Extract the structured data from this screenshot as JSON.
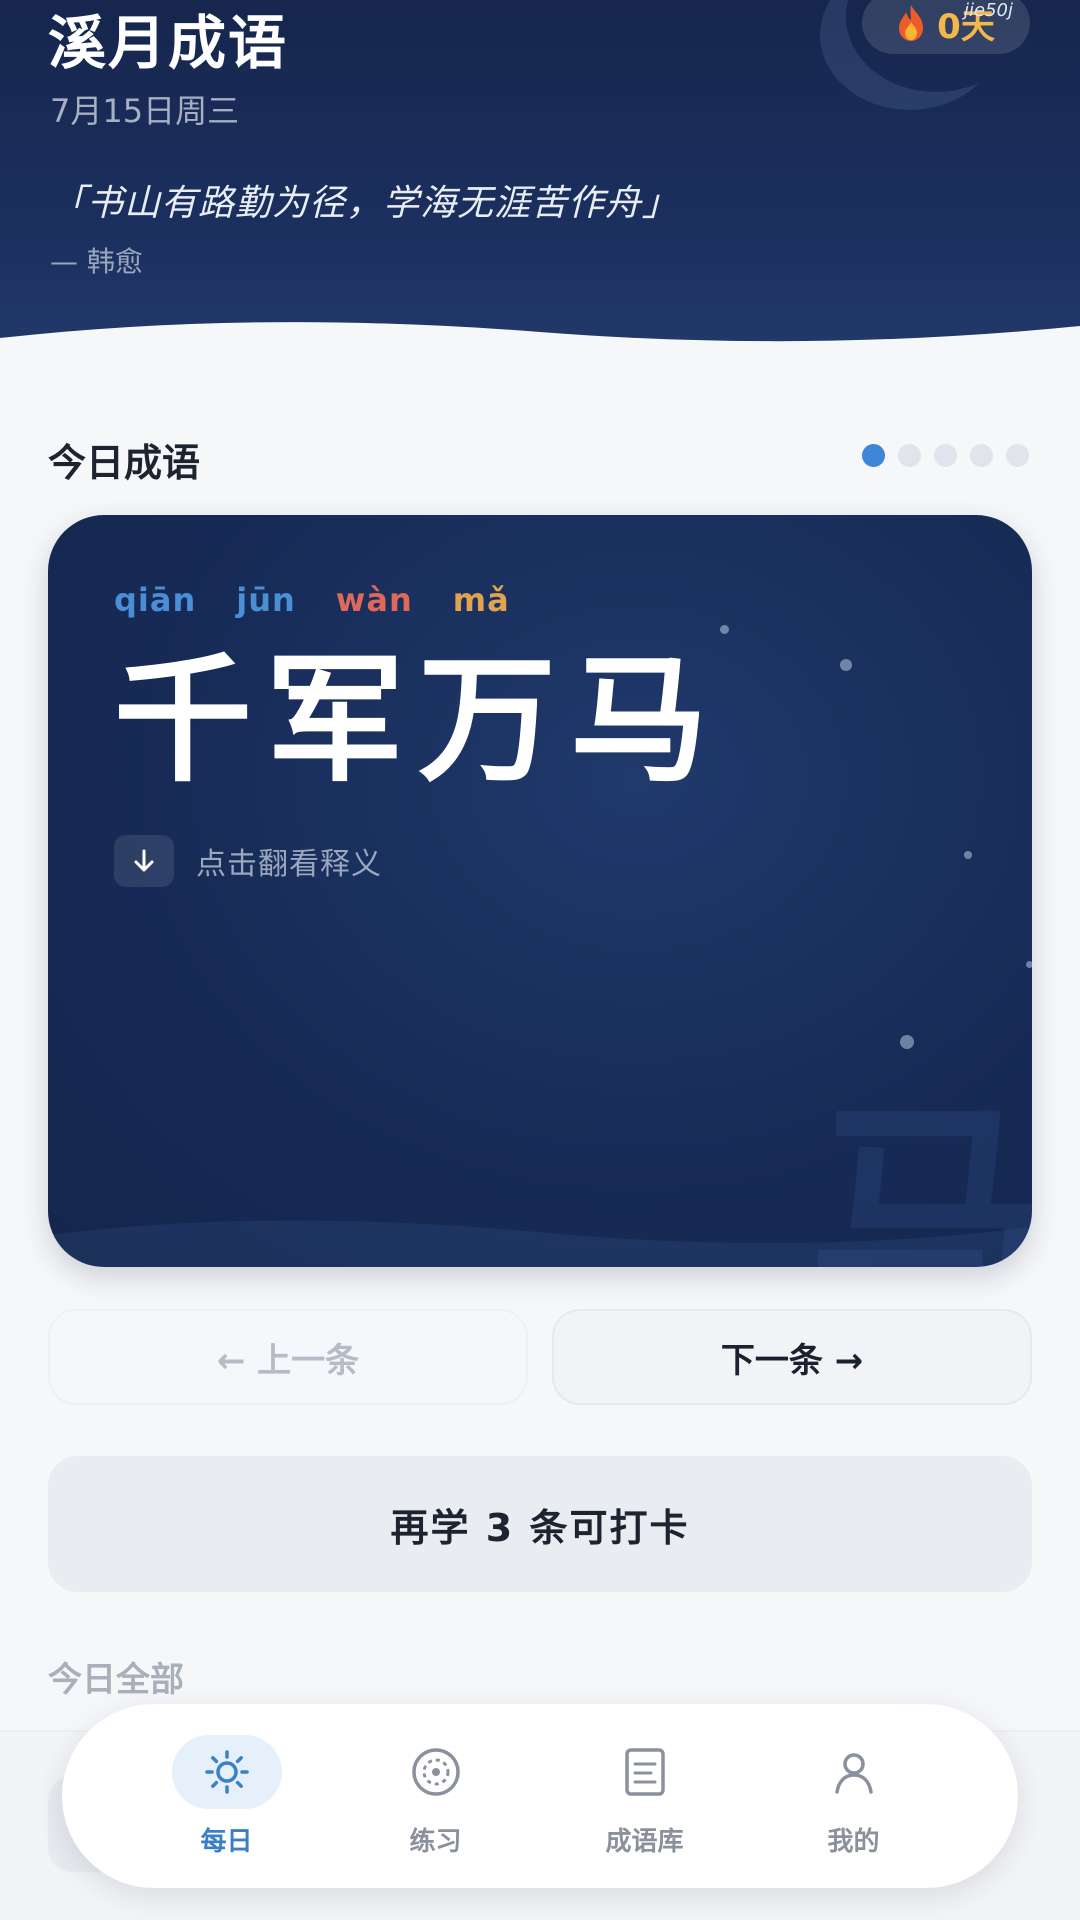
{
  "header": {
    "app_title": "溪月成语",
    "date": "7月15日周三",
    "quote": "「书山有路勤为径，学海无涯苦作舟」",
    "author": "— 韩愈",
    "streak_label": "0天",
    "watermark": "jie50j",
    "streak_icon": "flame-icon"
  },
  "today": {
    "section_title": "今日成语",
    "page_count": 5,
    "current_page": 1,
    "card": {
      "pinyin": [
        {
          "text": "qiān",
          "color": "#4a8fd6"
        },
        {
          "text": "jūn",
          "color": "#4a8fd6"
        },
        {
          "text": "wàn",
          "color": "#e0685a"
        },
        {
          "text": "mǎ",
          "color": "#e2a34e"
        }
      ],
      "chars": [
        "千",
        "军",
        "万",
        "马"
      ],
      "reveal_label": "点击翻看释义",
      "reveal_icon": "arrow-down-icon",
      "ghost_char": "马"
    },
    "prev_label": "← 上一条",
    "next_label": "下一条 →",
    "checkin_label": "再学 3 条可打卡"
  },
  "all_section_title": "今日全部",
  "bottom_nav": [
    {
      "label": "每日",
      "icon": "sun-icon",
      "active": true
    },
    {
      "label": "练习",
      "icon": "target-icon",
      "active": false
    },
    {
      "label": "成语库",
      "icon": "book-icon",
      "active": false
    },
    {
      "label": "我的",
      "icon": "user-icon",
      "active": false
    }
  ],
  "colors": {
    "header_bg": "#1b2f5e",
    "accent": "#3d86d8",
    "streak": "#f2b84b"
  }
}
